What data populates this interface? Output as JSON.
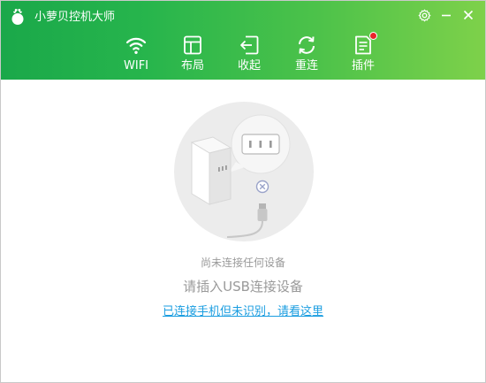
{
  "app": {
    "title": "小萝贝控机大师",
    "accent_color": "#27b54c",
    "link_color": "#1a9de0"
  },
  "window_controls": {
    "settings_icon": "gear-icon",
    "minimize_icon": "minimize-icon",
    "close_icon": "close-icon"
  },
  "toolbar": {
    "items": [
      {
        "label": "WIFI",
        "icon": "wifi-icon"
      },
      {
        "label": "布局",
        "icon": "layout-icon"
      },
      {
        "label": "收起",
        "icon": "collapse-icon"
      },
      {
        "label": "重连",
        "icon": "reconnect-icon"
      },
      {
        "label": "插件",
        "icon": "plugin-icon",
        "notification_dot": true
      }
    ]
  },
  "main": {
    "status_small": "尚未连接任何设备",
    "status_main": "请插入USB连接设备",
    "help_link": "已连接手机但未识别，请看这里"
  }
}
